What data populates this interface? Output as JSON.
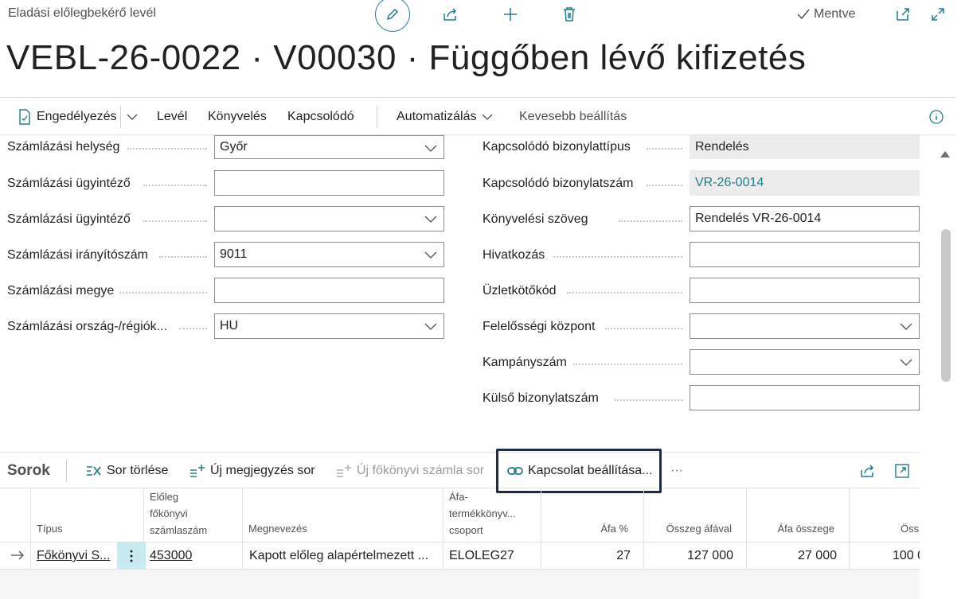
{
  "header": {
    "breadcrumb": "Eladási előlegbekérő levél",
    "saved_label": "Mentve",
    "title": "VEBL-26-0022 · V00030 · Függőben lévő kifizetés"
  },
  "actions": {
    "approve": "Engedélyezés",
    "letter": "Levél",
    "posting": "Könyvelés",
    "related": "Kapcsolódó",
    "automate": "Automatizálás",
    "fewer": "Kevesebb beállítás"
  },
  "form_left": [
    {
      "label": "Számlázási helység",
      "value": "Győr",
      "type": "dropdown"
    },
    {
      "label": "Számlázási ügyintéző",
      "value": "",
      "type": "text"
    },
    {
      "label": "Számlázási ügyintéző",
      "value": "",
      "type": "dropdown"
    },
    {
      "label": "Számlázási irányítószám",
      "value": "9011",
      "type": "dropdown"
    },
    {
      "label": "Számlázási megye",
      "value": "",
      "type": "text"
    },
    {
      "label": "Számlázási ország-/régiók...",
      "value": "HU",
      "type": "dropdown"
    }
  ],
  "form_right": [
    {
      "label": "Kapcsolódó bizonylattípus",
      "value": "Rendelés",
      "type": "readonly"
    },
    {
      "label": "Kapcsolódó bizonylatszám",
      "value": "VR-26-0014",
      "type": "readonly-link"
    },
    {
      "label": "Könyvelési szöveg",
      "value": "Rendelés VR-26-0014",
      "type": "text"
    },
    {
      "label": "Hivatkozás",
      "value": "",
      "type": "text"
    },
    {
      "label": "Üzletkötőkód",
      "value": "",
      "type": "text"
    },
    {
      "label": "Felelősségi központ",
      "value": "",
      "type": "dropdown"
    },
    {
      "label": "Kampányszám",
      "value": "",
      "type": "dropdown"
    },
    {
      "label": "Külső bizonylatszám",
      "value": "",
      "type": "text"
    }
  ],
  "lines": {
    "title": "Sorok",
    "delete_row": "Sor törlése",
    "new_comment": "Új megjegyzés sor",
    "new_gl": "Új főkönyvi számla sor",
    "set_link": "Kapcsolat beállítása...",
    "more": "···",
    "columns": {
      "type": "Típus",
      "account_1": "Előleg",
      "account_2": "főkönyvi",
      "account_3": "számlaszám",
      "description": "Megnevezés",
      "vat_1": "Áfa-",
      "vat_2": "termékkönyv...",
      "vat_3": "csoport",
      "vat_pct": "Áfa %",
      "amount_incl": "Összeg áfával",
      "vat_amount": "Áfa összege",
      "amount": "Öss"
    },
    "row": {
      "type": "Főkönyvi S...",
      "account": "453000",
      "description": "Kapott előleg alapértelmezett ...",
      "vat_group": "ELOLEG27",
      "vat_pct": "27",
      "amount_incl": "127 000",
      "vat_amount": "27 000",
      "amount": "100 0"
    }
  }
}
